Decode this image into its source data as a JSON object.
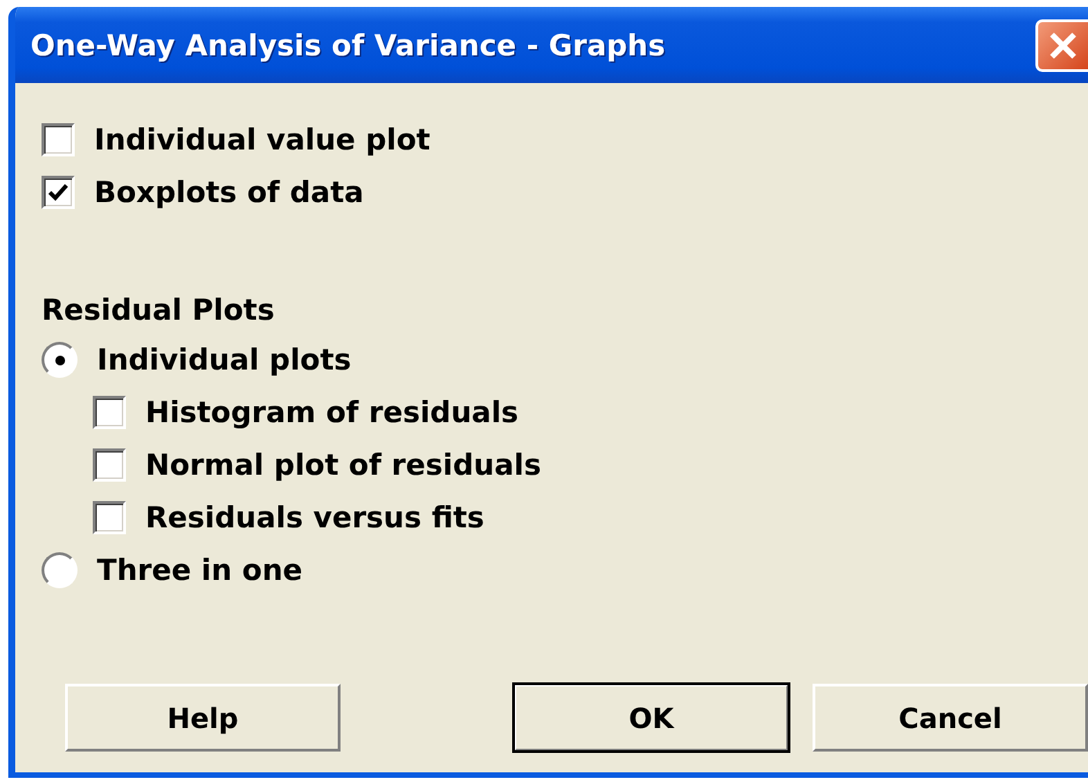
{
  "window": {
    "title": "One-Way Analysis of Variance - Graphs"
  },
  "options": [
    {
      "label": "Individual value plot",
      "checked": false
    },
    {
      "label": "Boxplots of data",
      "checked": true
    }
  ],
  "residual_plots": {
    "heading": "Residual Plots",
    "choices": [
      {
        "label": "Individual plots",
        "selected": true,
        "children": [
          {
            "label": "Histogram of residuals",
            "checked": false
          },
          {
            "label": "Normal plot of residuals",
            "checked": false
          },
          {
            "label": "Residuals versus fits",
            "checked": false
          }
        ]
      },
      {
        "label": "Three in one",
        "selected": false
      }
    ]
  },
  "buttons": [
    {
      "label": "Help",
      "default": false
    },
    {
      "label": "OK",
      "default": true
    },
    {
      "label": "Cancel",
      "default": false
    }
  ]
}
